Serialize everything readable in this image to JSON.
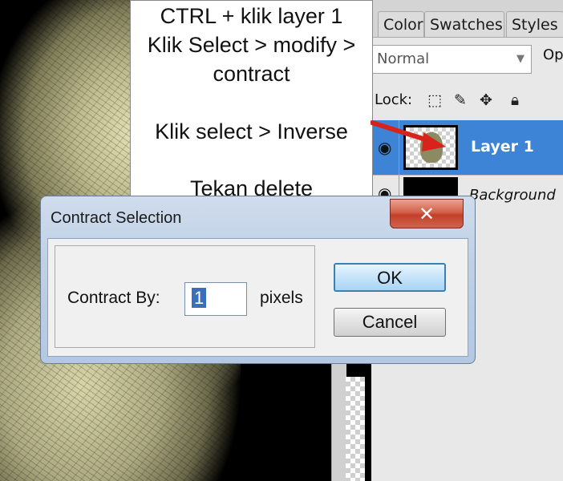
{
  "instructions": {
    "line1": "CTRL + klik layer 1",
    "line2": "Klik Select > modify >",
    "line3": "contract",
    "line4": "Klik select > Inverse",
    "line5": "Tekan delete"
  },
  "panels": {
    "tabs": [
      "Color",
      "Swatches",
      "Styles"
    ],
    "blend_mode": "Normal",
    "opacity_label": "Op",
    "lock_label": "Lock:",
    "layers": [
      {
        "name": "Layer 1",
        "selected": true
      },
      {
        "name": "Background",
        "selected": false
      }
    ],
    "accent": "#3d84d6"
  },
  "dialog": {
    "title": "Contract Selection",
    "close_glyph": "✕",
    "label": "Contract By:",
    "value": "1",
    "unit": "pixels",
    "ok_label": "OK",
    "cancel_label": "Cancel"
  },
  "icons": [
    "eye-icon",
    "lock-transparent-icon",
    "lock-brush-icon",
    "lock-move-icon",
    "lock-all-icon",
    "close-icon",
    "arrow-annotation"
  ]
}
